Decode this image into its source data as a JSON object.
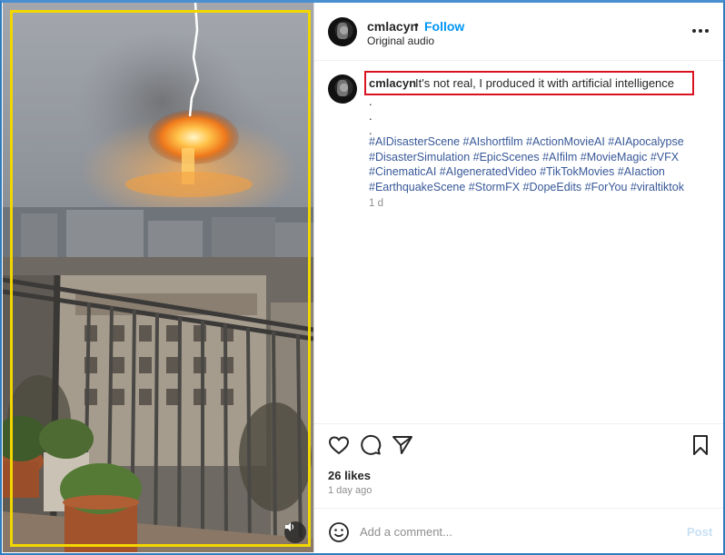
{
  "post": {
    "username": "cmlacyn",
    "separator": "•",
    "follow_label": "Follow",
    "audio_label": "Original audio",
    "caption": "It's not real, I produced it with artificial intelligence",
    "caption_dots": [
      ".",
      ".",
      "."
    ],
    "hashtag_lines": [
      "#AIDisasterScene #AIshortfilm #ActionMovieAI #AIApocalypse",
      "#DisasterSimulation #EpicScenes #AIfilm #MovieMagic #VFX",
      "#CinematicAI #AIgeneratedVideo #TikTokMovies #AIaction",
      "#EarthquakeScene #StormFX #DopeEdits #ForYou #viraltiktok"
    ],
    "caption_age": "1 d",
    "likes": "26 likes",
    "posted": "1 day ago"
  },
  "comment": {
    "placeholder": "Add a comment...",
    "post_label": "Post"
  },
  "icons": {
    "more": "more-options-icon",
    "like": "heart-icon",
    "comment": "comment-icon",
    "share": "paper-plane-icon",
    "save": "bookmark-icon",
    "emoji": "emoji-icon",
    "sound": "speaker-icon"
  },
  "colors": {
    "follow": "#0095f6",
    "hashtag": "#385898",
    "highlight_box": "#d9121f",
    "media_box": "#f2d600"
  }
}
